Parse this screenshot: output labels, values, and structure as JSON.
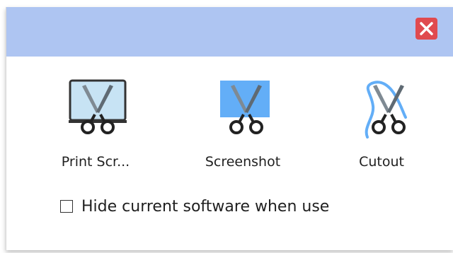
{
  "titlebar": {
    "color": "#aec5f2",
    "close_icon": "close-icon",
    "close_color": "#e04a4f"
  },
  "tools": [
    {
      "id": "print-screen",
      "label": "Print Scr...",
      "icon": "print-screen-icon"
    },
    {
      "id": "screenshot",
      "label": "Screenshot",
      "icon": "screenshot-icon"
    },
    {
      "id": "cutout",
      "label": "Cutout",
      "icon": "cutout-icon"
    }
  ],
  "options": {
    "hide_software_label": "Hide current software when use",
    "hide_software_checked": false
  },
  "colors": {
    "accent_blue": "#63aef7",
    "scissor_blade": "#7f8a93",
    "scissor_handle": "#222222"
  }
}
